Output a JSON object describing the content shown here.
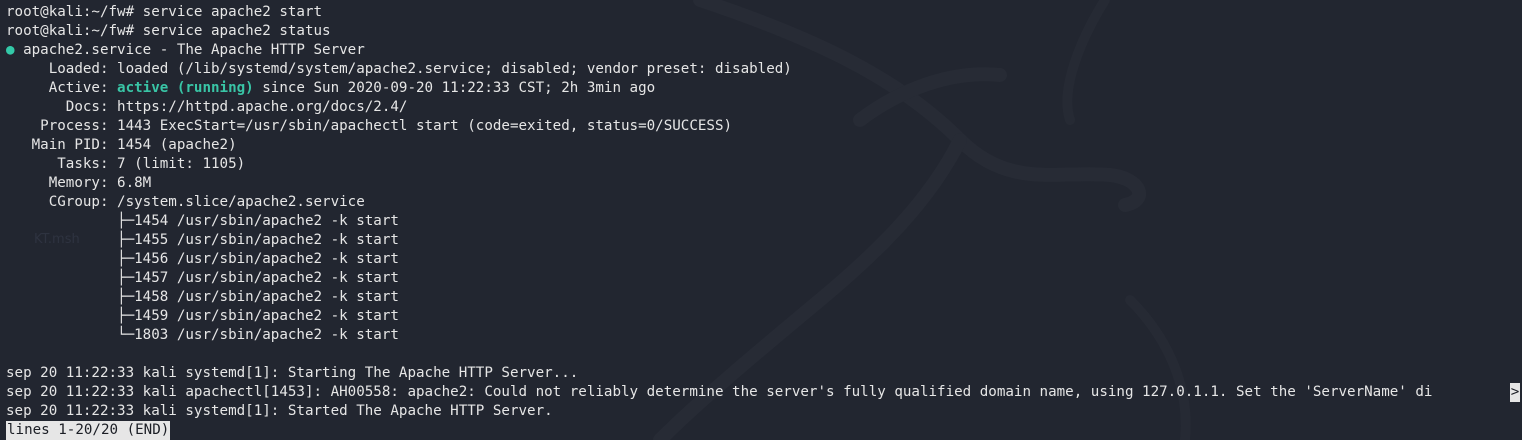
{
  "bg_hint": "kali_term",
  "terminal": {
    "prompt_lines": [
      "root@kali:~/fw# service apache2 start",
      "root@kali:~/fw# service apache2 status"
    ],
    "service_dot": "●",
    "service_title": " apache2.service - The Apache HTTP Server",
    "loaded": "     Loaded: loaded (/lib/systemd/system/apache2.service; disabled; vendor preset: disabled)",
    "active_prefix": "     Active: ",
    "active_state": "active (running)",
    "active_suffix": " since Sun 2020-09-20 11:22:33 CST; 2h 3min ago",
    "docs": "       Docs: https://httpd.apache.org/docs/2.4/",
    "process": "    Process: 1443 ExecStart=/usr/sbin/apachectl start (code=exited, status=0/SUCCESS)",
    "main_pid": "   Main PID: 1454 (apache2)",
    "tasks": "      Tasks: 7 (limit: 1105)",
    "memory": "     Memory: 6.8M",
    "cgroup": "     CGroup: /system.slice/apache2.service",
    "cgroup_tree": [
      "             ├─1454 /usr/sbin/apache2 -k start",
      "             ├─1455 /usr/sbin/apache2 -k start",
      "             ├─1456 /usr/sbin/apache2 -k start",
      "             ├─1457 /usr/sbin/apache2 -k start",
      "             ├─1458 /usr/sbin/apache2 -k start",
      "             ├─1459 /usr/sbin/apache2 -k start",
      "             └─1803 /usr/sbin/apache2 -k start"
    ],
    "log_lines": [
      "sep 20 11:22:33 kali systemd[1]: Starting The Apache HTTP Server...",
      "sep 20 11:22:33 kali apachectl[1453]: AH00558: apache2: Could not reliably determine the server's fully qualified domain name, using 127.0.1.1. Set the 'ServerName' di",
      "sep 20 11:22:33 kali systemd[1]: Started The Apache HTTP Server."
    ],
    "truncation_marker": ">",
    "pager_status": "lines 1-20/20 (END)",
    "background_label": "KT.msh"
  },
  "colors": {
    "background": "#222630",
    "text": "#e6e6e6",
    "active_green": "#39c5a6",
    "dot_green": "#33c9a8"
  }
}
